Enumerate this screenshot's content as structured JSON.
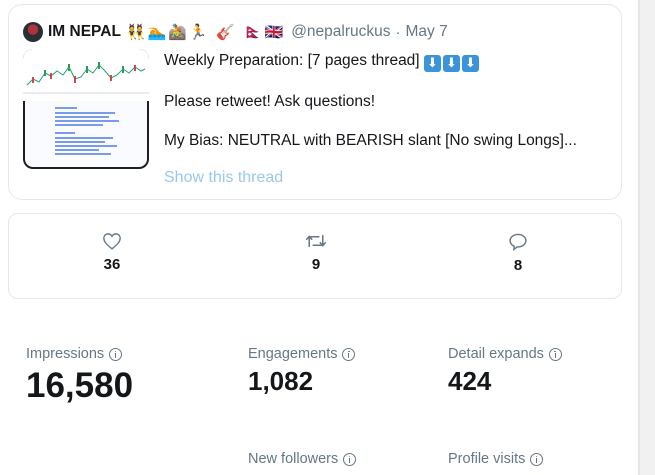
{
  "tweet": {
    "display_name": "IM NEPAL",
    "name_emojis": "👯🏊🚵🏃 🎸 🇳🇵🇬🇧",
    "handle": "@nepalruckus",
    "separator": "·",
    "date": "May 7",
    "media_icon": "chart-screenshot-thumbnail",
    "text_line1": "Weekly Preparation:  [7 pages thread]",
    "text_line1_arrows": [
      "⬇",
      "⬇",
      "⬇"
    ],
    "text_line2": "Please retweet! Ask questions!",
    "text_line3": "My Bias: NEUTRAL with BEARISH slant [No swing Longs]...",
    "show_thread_label": "Show this thread"
  },
  "engagement": {
    "likes": {
      "icon": "heart-icon",
      "count": "36"
    },
    "retweets": {
      "icon": "retweet-icon",
      "count": "9"
    },
    "replies": {
      "icon": "reply-icon",
      "count": "8"
    }
  },
  "stats": {
    "impressions": {
      "label": "Impressions",
      "value": "16,580"
    },
    "engagements": {
      "label": "Engagements",
      "value": "1,082"
    },
    "detail_expands": {
      "label": "Detail expands",
      "value": "424"
    },
    "new_followers": {
      "label": "New followers"
    },
    "profile_visits": {
      "label": "Profile visits"
    }
  },
  "colors": {
    "link": "#99c8ee",
    "muted": "#657786",
    "border": "#e1e8ed",
    "arrow_box": "#3b94d9"
  }
}
